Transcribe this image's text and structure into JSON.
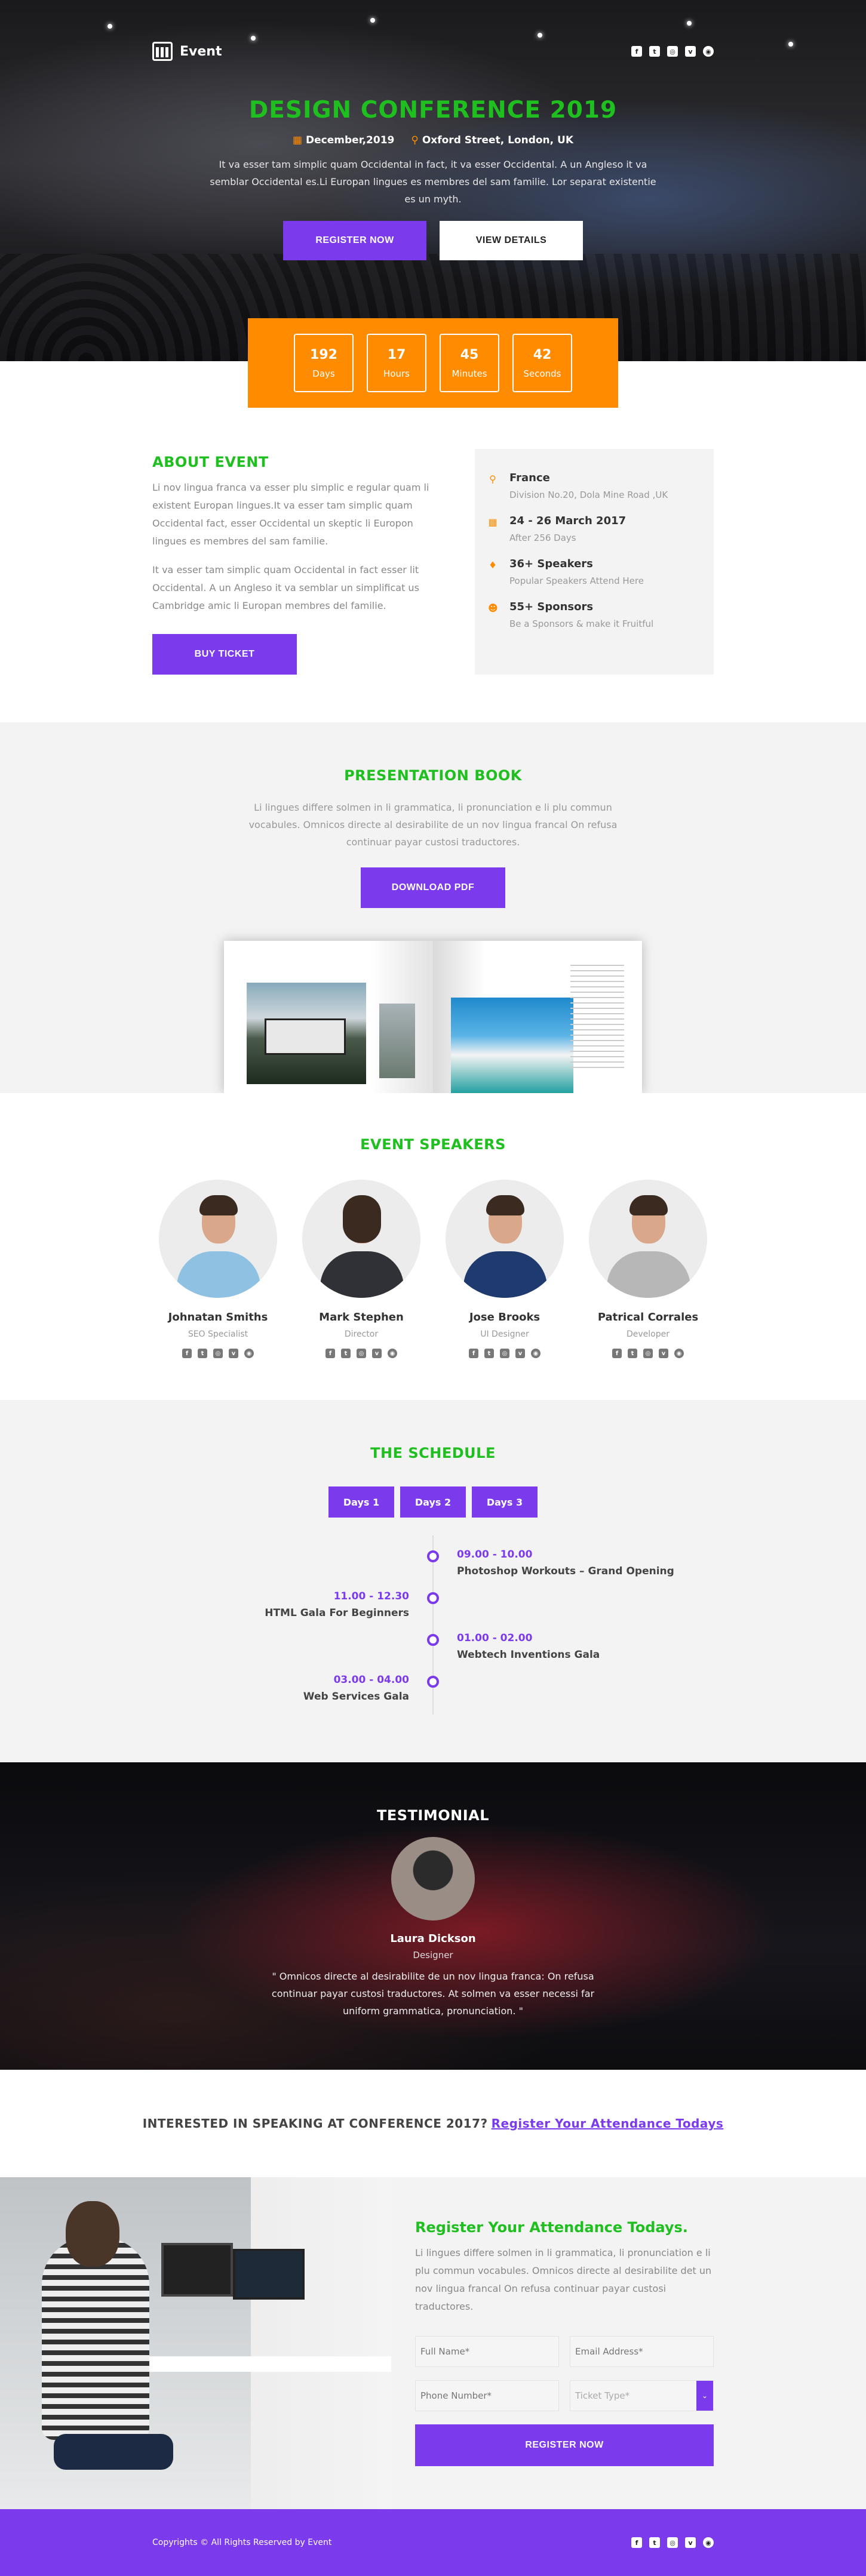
{
  "brand": {
    "name": "Event"
  },
  "socials": [
    "f",
    "t",
    "◎",
    "v",
    "◉"
  ],
  "hero": {
    "title": "DESIGN CONFERENCE 2019",
    "date": "December,2019",
    "location": "Oxford Street, London, UK",
    "description": "It va esser tam simplic quam Occidental in fact, it va esser Occidental. A un Angleso it va semblar Occidental es.Li Europan lingues es membres del sam familie. Lor separat existentie es un myth.",
    "register_label": "REGISTER NOW",
    "details_label": "VIEW DETAILS"
  },
  "countdown": [
    {
      "value": "192",
      "label": "Days"
    },
    {
      "value": "17",
      "label": "Hours"
    },
    {
      "value": "45",
      "label": "Minutes"
    },
    {
      "value": "42",
      "label": "Seconds"
    }
  ],
  "about": {
    "title": "ABOUT EVENT",
    "p1": "Li nov lingua franca va esser plu simplic e regular quam li existent Europan lingues.It va esser tam simplic quam Occidental fact, esser Occidental un skeptic li Europon lingues es membres del sam familie.",
    "p2": "It va esser tam simplic quam Occidental in fact esser lit Occidental. A un Angleso it va semblar un simplificat us Cambridge amic li Europan membres del familie.",
    "button": "BUY TICKET",
    "info": [
      {
        "icon": "map-pin-icon",
        "title": "France",
        "sub": "Division No.20, Dola Mine Road ,UK"
      },
      {
        "icon": "calendar-icon",
        "title": "24 - 26 March 2017",
        "sub": "After 256 Days"
      },
      {
        "icon": "microphone-icon",
        "title": "36+ Speakers",
        "sub": "Popular Speakers Attend Here"
      },
      {
        "icon": "user-add-icon",
        "title": "55+ Sponsors",
        "sub": "Be a Sponsors & make it Fruitful"
      }
    ]
  },
  "book": {
    "title": "PRESENTATION BOOK",
    "description": "Li lingues differe solmen in li grammatica, li pronunciation e li plu commun vocabules. Omnicos directe al desirabilite de un nov lingua francal On refusa continuar payar custosi traductores.",
    "button": "DOWNLOAD PDF"
  },
  "speakers": {
    "title": "EVENT SPEAKERS",
    "items": [
      {
        "name": "Johnatan Smiths",
        "role": "SEO Specialist",
        "color": "#8fc1e3"
      },
      {
        "name": "Mark Stephen",
        "role": "Director",
        "color": "#2f3136"
      },
      {
        "name": "Jose Brooks",
        "role": "UI Designer",
        "color": "#1e3a6e"
      },
      {
        "name": "Patrical Corrales",
        "role": "Developer",
        "color": "#b7b7b7"
      }
    ]
  },
  "schedule": {
    "title": "THE SCHEDULE",
    "tabs": [
      "Days 1",
      "Days 2",
      "Days 3"
    ],
    "items": [
      {
        "time": "09.00 - 10.00",
        "title": "Photoshop Workouts – Grand Opening"
      },
      {
        "time": "11.00 - 12.30",
        "title": "HTML Gala For Beginners"
      },
      {
        "time": "01.00 - 02.00",
        "title": "Webtech Inventions Gala"
      },
      {
        "time": "03.00 - 04.00",
        "title": "Web Services Gala"
      }
    ]
  },
  "testimonial": {
    "title": "TESTIMONIAL",
    "name": "Laura Dickson",
    "role": "Designer",
    "quote": "\" Omnicos directe al desirabilite de un nov lingua franca: On refusa continuar payar custosi traductores. At solmen va esser necessi far uniform grammatica, pronunciation. \""
  },
  "speak": {
    "text": "INTERESTED IN SPEAKING AT CONFERENCE 2017?",
    "link": "Register Your Attendance Todays"
  },
  "register": {
    "title": "Register Your Attendance Todays.",
    "description": "Li lingues differe solmen in li grammatica, li pronunciation e li plu commun vocabules. Omnicos directe al desirabilite det un nov lingua francal On refusa continuar payar custosi traductores.",
    "name_placeholder": "Full Name*",
    "email_placeholder": "Email Address*",
    "phone_placeholder": "Phone Number*",
    "ticket_placeholder": "Ticket Type*",
    "button": "REGISTER NOW"
  },
  "footer": {
    "copyright": "Copyrights © All Rights Reserved by Event"
  }
}
